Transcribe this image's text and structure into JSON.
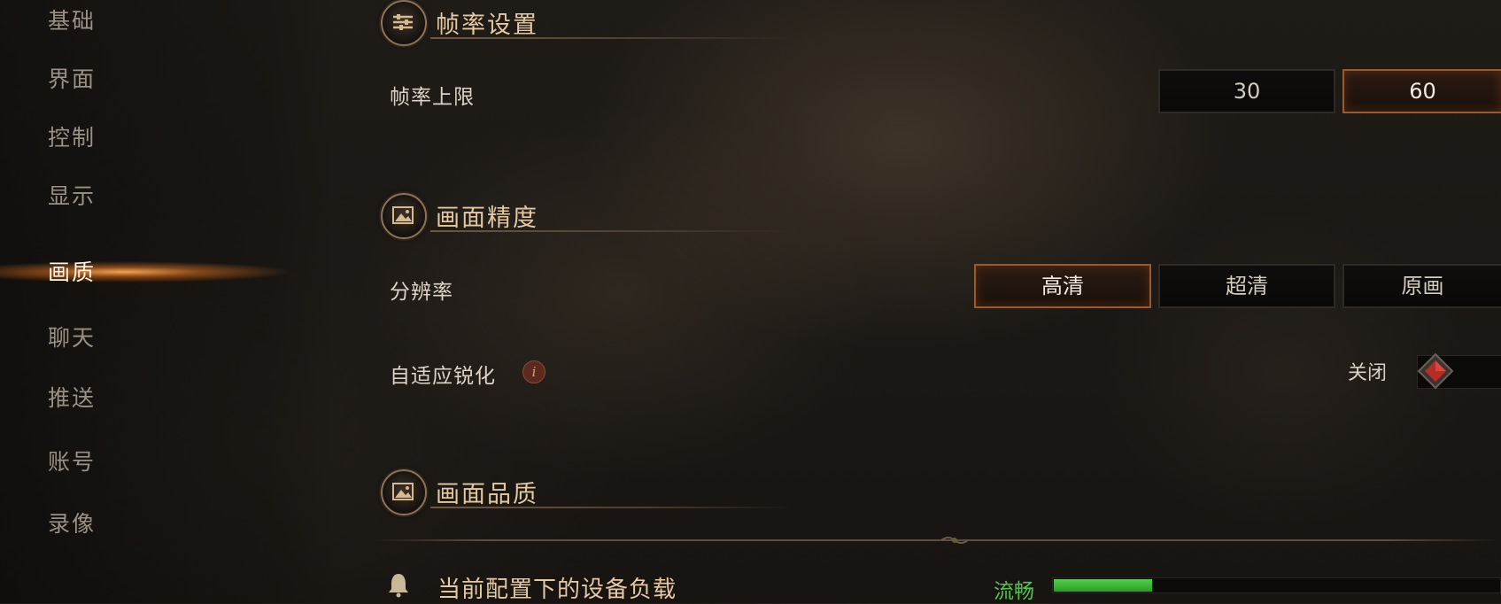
{
  "sidebar": {
    "items": [
      {
        "label": "基础",
        "active": false
      },
      {
        "label": "界面",
        "active": false
      },
      {
        "label": "控制",
        "active": false
      },
      {
        "label": "显示",
        "active": false
      },
      {
        "label": "画质",
        "active": true
      },
      {
        "label": "聊天",
        "active": false
      },
      {
        "label": "推送",
        "active": false
      },
      {
        "label": "账号",
        "active": false
      },
      {
        "label": "录像",
        "active": false
      }
    ]
  },
  "sections": {
    "frame_rate": {
      "title": "帧率设置",
      "icon": "sliders-icon",
      "cap_label": "帧率上限",
      "options": [
        "30",
        "60"
      ],
      "selected": "60"
    },
    "precision": {
      "title": "画面精度",
      "icon": "picture-icon",
      "resolution_label": "分辨率",
      "options": [
        "高清",
        "超清",
        "原画"
      ],
      "selected": "高清",
      "sharpen_label": "自适应锐化",
      "sharpen_state": "关闭"
    },
    "quality": {
      "title": "画面品质",
      "icon": "picture-icon"
    }
  },
  "device_load": {
    "label": "当前配置下的设备负载",
    "status": "流畅",
    "level": 0.22,
    "status_color": "#52c548"
  },
  "colors": {
    "accent": "#9a5a2c",
    "title_gold": "#e4c9a2"
  }
}
